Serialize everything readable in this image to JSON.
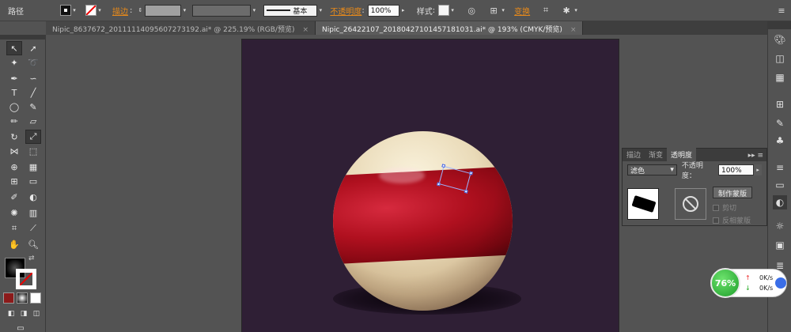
{
  "controlbar": {
    "path_label": "路径",
    "stroke_label": "描边",
    "brush_label": "基本",
    "opacity_label": "不透明度",
    "opacity_value": "100%",
    "style_label": "样式",
    "transform_label": "变换"
  },
  "tabs": [
    {
      "label": "Nipic_8637672_20111114095607273192.ai* @ 225.19% (RGB/预览)",
      "close": "×"
    },
    {
      "label": "Nipic_26422107_20180427101457181031.ai* @ 193% (CMYK/预览)",
      "close": "×"
    }
  ],
  "panel": {
    "tabs": [
      "描边",
      "渐变",
      "透明度"
    ],
    "blend_mode": "滤色",
    "opacity_label": "不透明度：",
    "opacity_value": "100%",
    "make_mask": "制作蒙版",
    "clip": "剪切",
    "invert_mask": "反相蒙版"
  },
  "speed": {
    "percent": "76%",
    "up": "0K/s",
    "down": "0K/s"
  },
  "colors": {
    "artboard": "#2f1f35",
    "band_red": "#b0101f",
    "ball_cream": "#eadbb9",
    "ui_dark": "#535353",
    "accent_orange": "#e88a1a"
  }
}
